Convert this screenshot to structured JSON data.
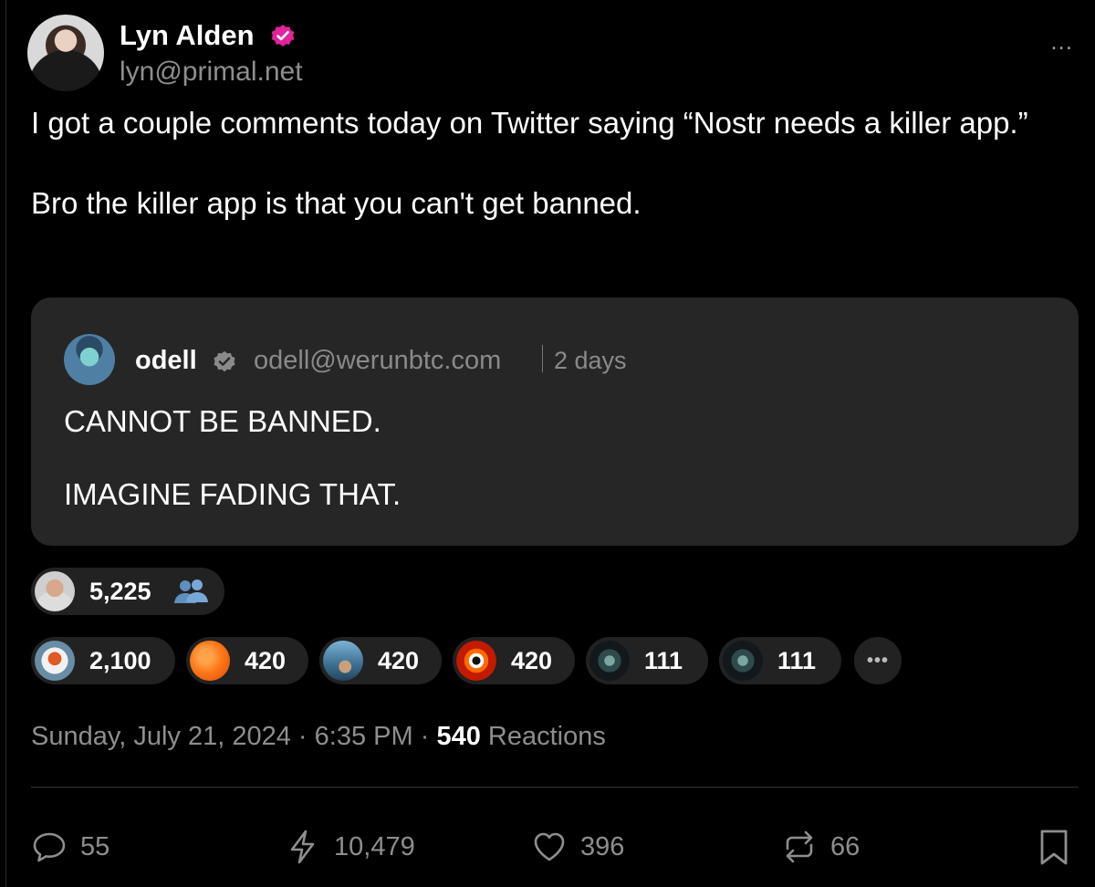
{
  "author": {
    "name": "Lyn Alden",
    "handle": "lyn@primal.net"
  },
  "more_label": "...",
  "post": {
    "text": "I got a couple comments today on Twitter saying “Nostr needs a killer app.”\n\nBro the killer app is that you can't get banned."
  },
  "quote": {
    "name": "odell",
    "handle": "odell@werunbtc.com",
    "time": "2 days",
    "line1": "CANNOT BE BANNED.",
    "line2": "IMAGINE FADING THAT."
  },
  "zaps": {
    "top": {
      "count": "5,225"
    },
    "items": [
      {
        "count": "2,100"
      },
      {
        "count": "420"
      },
      {
        "count": "420"
      },
      {
        "count": "420"
      },
      {
        "count": "111"
      },
      {
        "count": "111"
      }
    ],
    "more_label": "•••"
  },
  "meta": {
    "date": "Sunday, July 21, 2024",
    "sep1": "·",
    "time": "6:35 PM",
    "sep2": "·",
    "reactions_count": "540",
    "reactions_label": "Reactions"
  },
  "actions": {
    "replies": "55",
    "zaps": "10,479",
    "likes": "396",
    "reposts": "66"
  },
  "colors": {
    "background": "#000000",
    "card": "#262626",
    "verified_badge": "#e0249a",
    "muted_text": "#8e8e8e"
  },
  "icons": [
    "verified-badge-icon",
    "more-icon",
    "group-icon",
    "reply-icon",
    "zap-icon",
    "like-icon",
    "repost-icon",
    "bookmark-icon"
  ]
}
